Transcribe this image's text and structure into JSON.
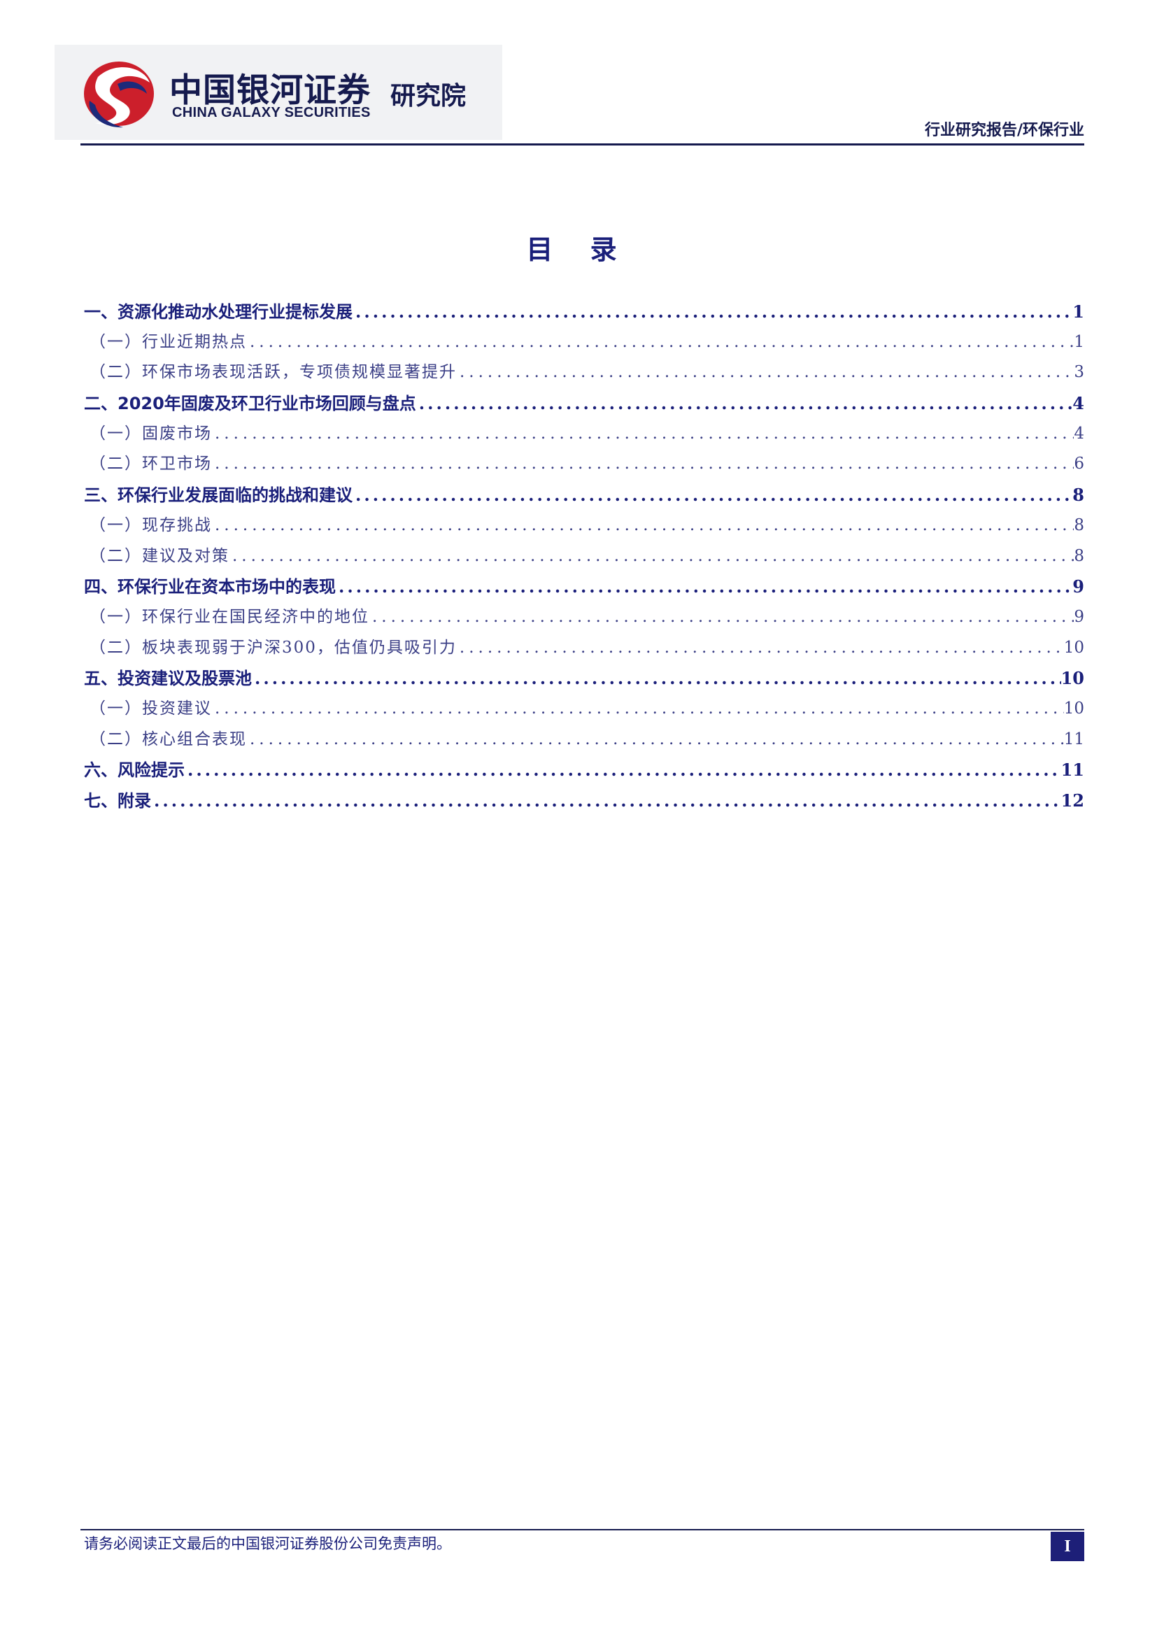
{
  "header": {
    "logo_cn": "中国银河证券",
    "logo_en": "CHINA GALAXY SECURITIES",
    "logo_inst": "研究院",
    "report_type": "行业研究报告/环保行业"
  },
  "toc": {
    "title": "目 录",
    "items": [
      {
        "level": 1,
        "text": "一、资源化推动水处理行业提标发展",
        "page": "1"
      },
      {
        "level": 2,
        "text": "（一）行业近期热点",
        "page": "1"
      },
      {
        "level": 2,
        "text": "（二）环保市场表现活跃，专项债规模显著提升",
        "page": "3"
      },
      {
        "level": 1,
        "text": "二、2020年固废及环卫行业市场回顾与盘点",
        "page": "4"
      },
      {
        "level": 2,
        "text": "（一）固废市场",
        "page": "4"
      },
      {
        "level": 2,
        "text": "（二）环卫市场",
        "page": "6"
      },
      {
        "level": 1,
        "text": "三、环保行业发展面临的挑战和建议",
        "page": "8"
      },
      {
        "level": 2,
        "text": "（一）现存挑战",
        "page": "8"
      },
      {
        "level": 2,
        "text": "（二）建议及对策",
        "page": "8"
      },
      {
        "level": 1,
        "text": "四、环保行业在资本市场中的表现",
        "page": "9"
      },
      {
        "level": 2,
        "text": "（一）环保行业在国民经济中的地位",
        "page": "9"
      },
      {
        "level": 2,
        "text": "（二）板块表现弱于沪深300，估值仍具吸引力",
        "page": "10"
      },
      {
        "level": 1,
        "text": "五、投资建议及股票池",
        "page": "10"
      },
      {
        "level": 2,
        "text": "（一）投资建议",
        "page": "10"
      },
      {
        "level": 2,
        "text": "（二）核心组合表现",
        "page": "11"
      },
      {
        "level": 1,
        "text": "六、风险提示",
        "page": "11"
      },
      {
        "level": 1,
        "text": "七、附录",
        "page": "12"
      }
    ]
  },
  "footer": {
    "disclaimer": "请务必阅读正文最后的中国银河证券股份公司免责声明。",
    "page_number": "I"
  },
  "colors": {
    "brand_navy": "#151a4e",
    "toc_blue": "#1a1f7a",
    "logo_red": "#cc1f2b",
    "logo_blue": "#1d2a7a"
  }
}
